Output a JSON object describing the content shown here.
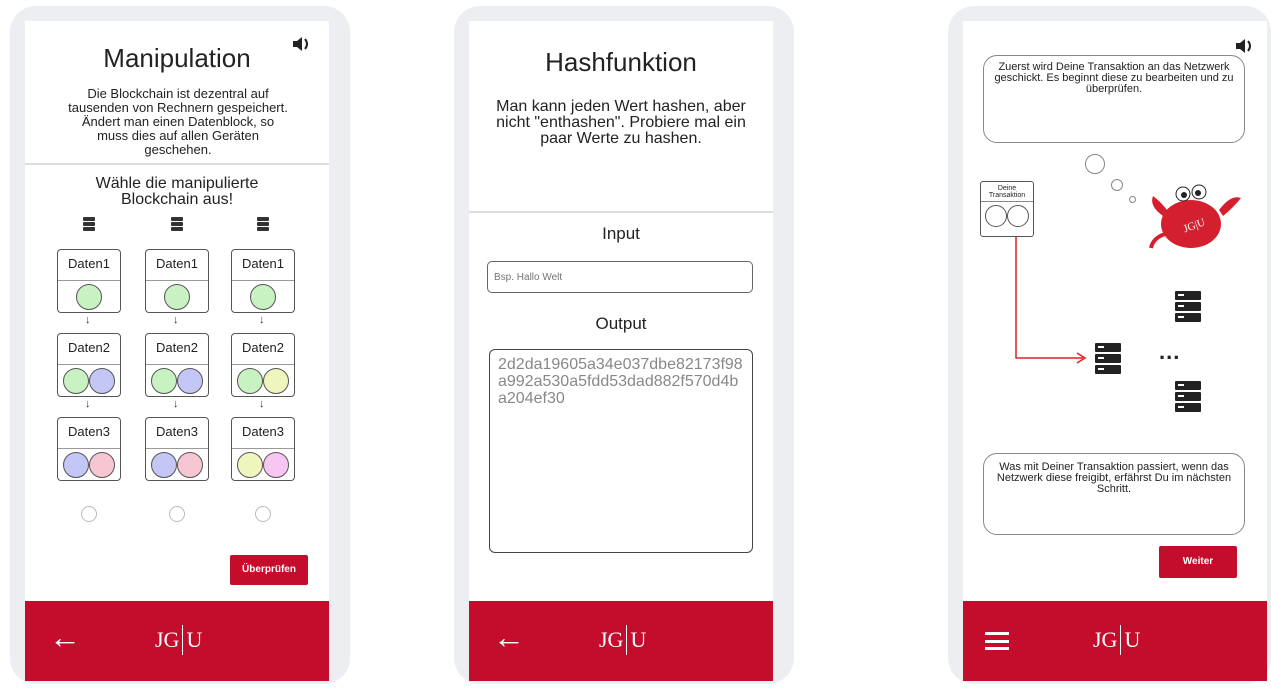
{
  "screen1": {
    "title": "Manipulation",
    "intro": "Die Blockchain ist dezentral auf tausenden von Rechnern gespeichert. Ändert man einen Datenblock, so muss dies auf allen Geräten geschehen.",
    "prompt": "Wähle die manipulierte Blockchain aus!",
    "chains": [
      {
        "blocks": [
          {
            "label": "Daten1"
          },
          {
            "label": "Daten2"
          },
          {
            "label": "Daten3"
          }
        ]
      },
      {
        "blocks": [
          {
            "label": "Daten1"
          },
          {
            "label": "Daten2"
          },
          {
            "label": "Daten3"
          }
        ]
      },
      {
        "blocks": [
          {
            "label": "Daten1"
          },
          {
            "label": "Daten2"
          },
          {
            "label": "Daten3"
          }
        ]
      }
    ],
    "check_button": "Überprüfen",
    "colors": {
      "green": "#c9f2c2",
      "blue": "#c4c6f5",
      "pink": "#f7c6d3",
      "yellow": "#eef6bd",
      "magenta": "#f8c6f2"
    }
  },
  "screen2": {
    "title": "Hashfunktion",
    "intro": "Man kann jeden Wert hashen, aber nicht \"enthashen\". Probiere mal ein paar Werte zu hashen.",
    "input_label": "Input",
    "input_placeholder": "Bsp. Hallo Welt",
    "output_label": "Output",
    "output_value": "2d2da19605a34e037dbe82173f98a992a530a5fdd53dad882f570d4ba204ef30"
  },
  "screen3": {
    "top_text": "Zuerst wird Deine Transaktion an das Netzwerk geschickt. Es beginnt diese zu bearbeiten und zu überprüfen.",
    "transaction_label": "Deine Transaktion",
    "ellipsis": "...",
    "mascot_text": "JG|U",
    "bottom_text": "Was mit Deiner Transaktion passiert, wenn das Netzwerk diese freigibt, erfährst Du im nächsten Schritt.",
    "next_button": "Weiter"
  },
  "footer": {
    "logo_left": "JG",
    "logo_right": "U",
    "back_icon": "arrow-left-icon",
    "menu_icon": "hamburger-menu-icon"
  },
  "brand_color": "#c40d2c"
}
